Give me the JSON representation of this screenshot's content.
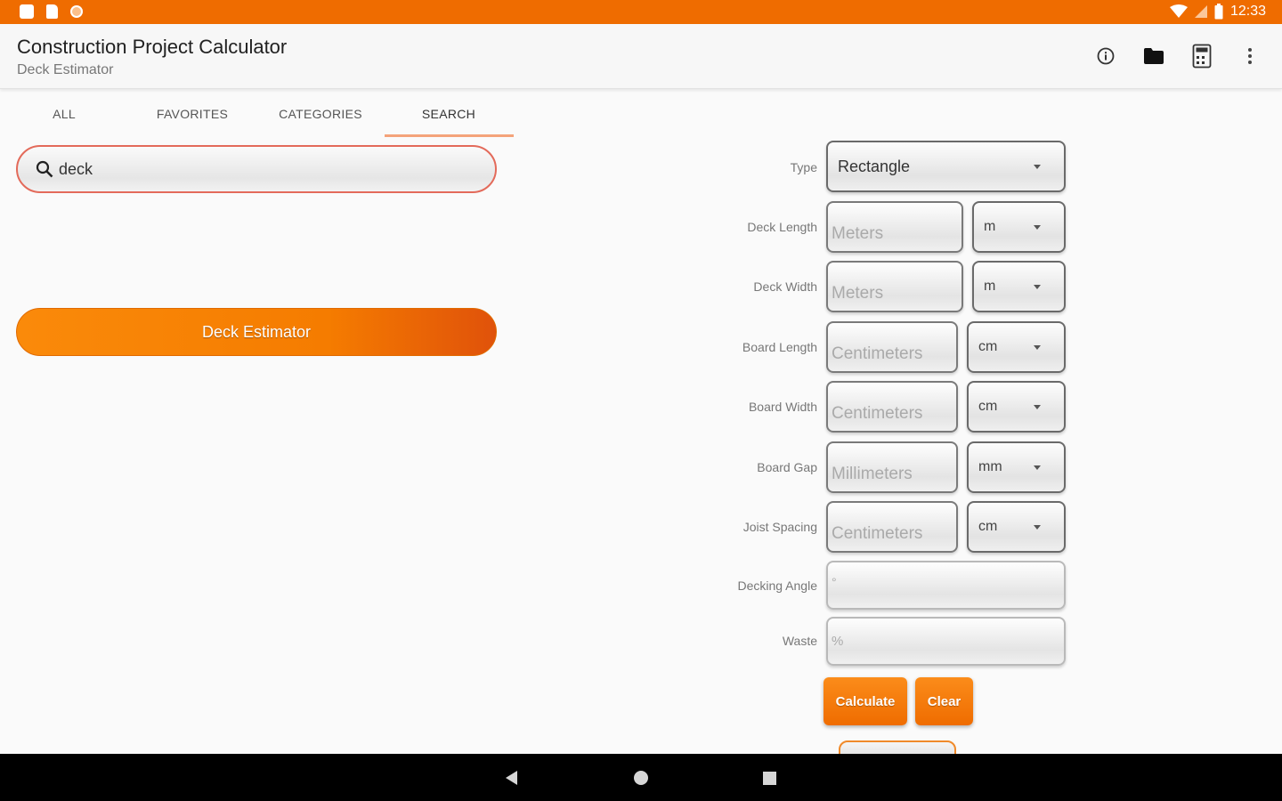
{
  "status_bar": {
    "time": "12:33"
  },
  "app_bar": {
    "title": "Construction Project Calculator",
    "subtitle": "Deck Estimator",
    "actions": [
      "info-icon",
      "folder-icon",
      "calculator-icon",
      "more-vert-icon"
    ]
  },
  "tabs": [
    {
      "label": "ALL"
    },
    {
      "label": "FAVORITES"
    },
    {
      "label": "CATEGORIES"
    },
    {
      "label": "SEARCH",
      "active": true
    }
  ],
  "search": {
    "value": "deck"
  },
  "results": [
    {
      "label": "Deck Estimator"
    }
  ],
  "form": {
    "type": {
      "label": "Type",
      "value": "Rectangle"
    },
    "deck_length": {
      "label": "Deck Length",
      "placeholder": "Meters",
      "unit": "m"
    },
    "deck_width": {
      "label": "Deck Width",
      "placeholder": "Meters",
      "unit": "m"
    },
    "board_length": {
      "label": "Board Length",
      "placeholder": "Centimeters",
      "unit": "cm"
    },
    "board_width": {
      "label": "Board Width",
      "placeholder": "Centimeters",
      "unit": "cm"
    },
    "board_gap": {
      "label": "Board Gap",
      "placeholder": "Millimeters",
      "unit": "mm"
    },
    "joist_spacing": {
      "label": "Joist Spacing",
      "placeholder": "Centimeters",
      "unit": "cm"
    },
    "decking_angle": {
      "label": "Decking Angle",
      "placeholder": "°"
    },
    "waste": {
      "label": "Waste",
      "placeholder": "%"
    },
    "calculate_label": "Calculate",
    "clear_label": "Clear"
  },
  "colors": {
    "accent": "#ef6c00",
    "tab_indicator": "#f4a37a",
    "search_border": "#e36a5a"
  }
}
